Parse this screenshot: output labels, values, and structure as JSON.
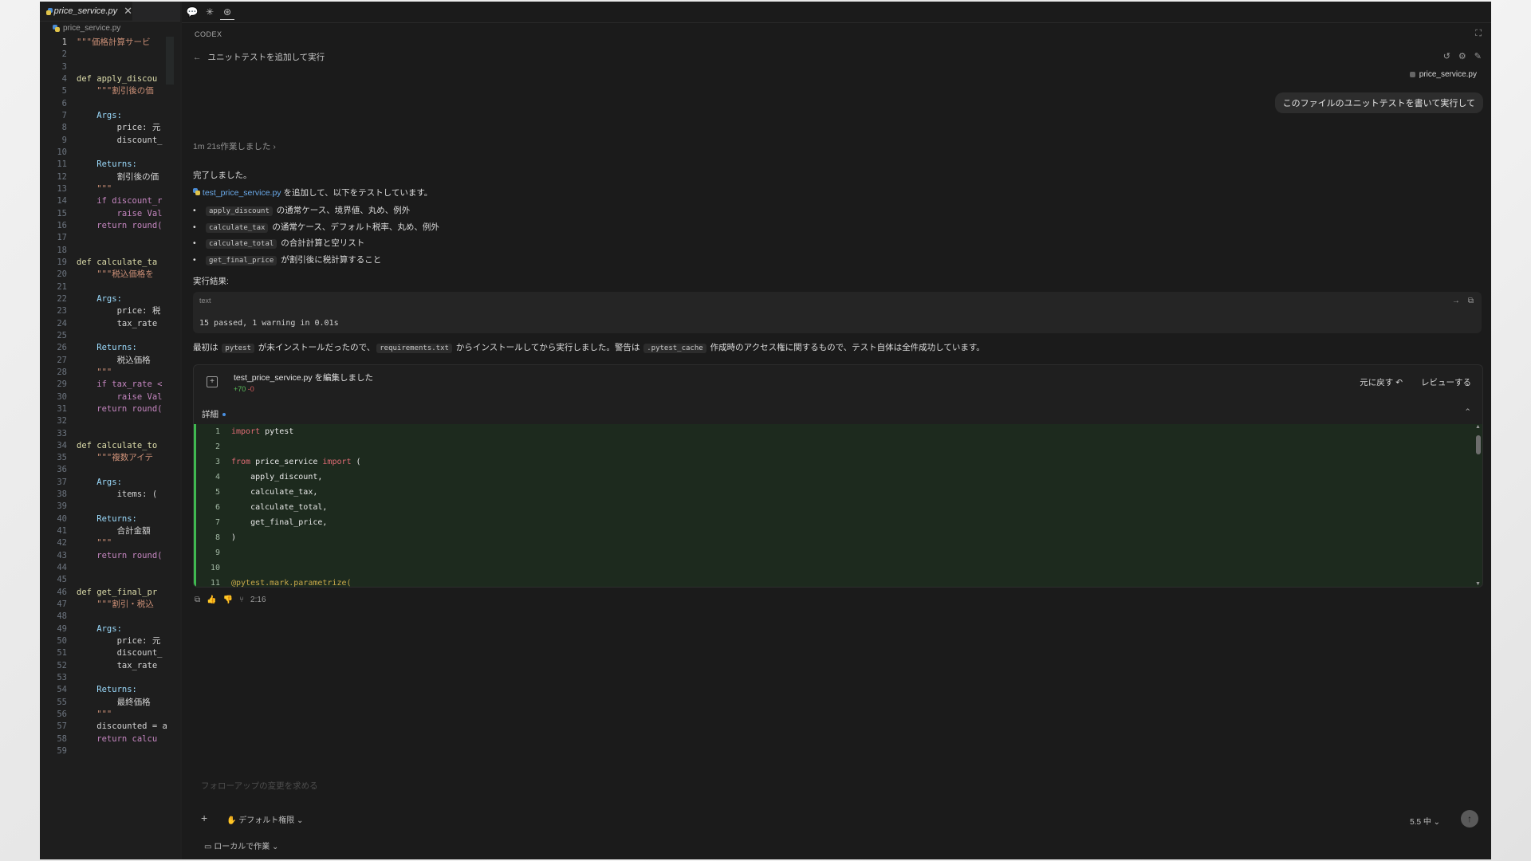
{
  "editor": {
    "tab_label": "price_service.py",
    "breadcrumb": "price_service.py",
    "lines": [
      {
        "n": "1",
        "t": "\"\"\"価格計算サービ"
      },
      {
        "n": "2",
        "t": ""
      },
      {
        "n": "3",
        "t": ""
      },
      {
        "n": "4",
        "t": "def apply_discou"
      },
      {
        "n": "5",
        "t": "    \"\"\"割引後の価"
      },
      {
        "n": "6",
        "t": ""
      },
      {
        "n": "7",
        "t": "    Args:"
      },
      {
        "n": "8",
        "t": "        price: 元"
      },
      {
        "n": "9",
        "t": "        discount_"
      },
      {
        "n": "10",
        "t": ""
      },
      {
        "n": "11",
        "t": "    Returns:"
      },
      {
        "n": "12",
        "t": "        割引後の価"
      },
      {
        "n": "13",
        "t": "    \"\"\""
      },
      {
        "n": "14",
        "t": "    if discount_r"
      },
      {
        "n": "15",
        "t": "        raise Val"
      },
      {
        "n": "16",
        "t": "    return round("
      },
      {
        "n": "17",
        "t": ""
      },
      {
        "n": "18",
        "t": ""
      },
      {
        "n": "19",
        "t": "def calculate_ta"
      },
      {
        "n": "20",
        "t": "    \"\"\"税込価格を"
      },
      {
        "n": "21",
        "t": ""
      },
      {
        "n": "22",
        "t": "    Args:"
      },
      {
        "n": "23",
        "t": "        price: 税"
      },
      {
        "n": "24",
        "t": "        tax_rate"
      },
      {
        "n": "25",
        "t": ""
      },
      {
        "n": "26",
        "t": "    Returns:"
      },
      {
        "n": "27",
        "t": "        税込価格"
      },
      {
        "n": "28",
        "t": "    \"\"\""
      },
      {
        "n": "29",
        "t": "    if tax_rate <"
      },
      {
        "n": "30",
        "t": "        raise Val"
      },
      {
        "n": "31",
        "t": "    return round("
      },
      {
        "n": "32",
        "t": ""
      },
      {
        "n": "33",
        "t": ""
      },
      {
        "n": "34",
        "t": "def calculate_to"
      },
      {
        "n": "35",
        "t": "    \"\"\"複数アイテ"
      },
      {
        "n": "36",
        "t": ""
      },
      {
        "n": "37",
        "t": "    Args:"
      },
      {
        "n": "38",
        "t": "        items: ("
      },
      {
        "n": "39",
        "t": ""
      },
      {
        "n": "40",
        "t": "    Returns:"
      },
      {
        "n": "41",
        "t": "        合計金額"
      },
      {
        "n": "42",
        "t": "    \"\"\""
      },
      {
        "n": "43",
        "t": "    return round("
      },
      {
        "n": "44",
        "t": ""
      },
      {
        "n": "45",
        "t": ""
      },
      {
        "n": "46",
        "t": "def get_final_pr"
      },
      {
        "n": "47",
        "t": "    \"\"\"割引・税込"
      },
      {
        "n": "48",
        "t": ""
      },
      {
        "n": "49",
        "t": "    Args:"
      },
      {
        "n": "50",
        "t": "        price: 元"
      },
      {
        "n": "51",
        "t": "        discount_"
      },
      {
        "n": "52",
        "t": "        tax_rate"
      },
      {
        "n": "53",
        "t": ""
      },
      {
        "n": "54",
        "t": "    Returns:"
      },
      {
        "n": "55",
        "t": "        最終価格"
      },
      {
        "n": "56",
        "t": "    \"\"\""
      },
      {
        "n": "57",
        "t": "    discounted = a"
      },
      {
        "n": "58",
        "t": "    return calcu"
      },
      {
        "n": "59",
        "t": ""
      }
    ]
  },
  "panel": {
    "header": "CODEX",
    "back_label": "ユニットテストを追加して実行",
    "file_chip": "price_service.py",
    "user_message": "このファイルのユニットテストを書いて実行して",
    "worked": "1m 21s作業しました",
    "done": "完了しました。",
    "added_file": "test_price_service.py",
    "added_suffix": " を追加して、以下をテストしています。",
    "bullets": [
      {
        "code": "apply_discount",
        "text": " の通常ケース、境界値、丸め、例外"
      },
      {
        "code": "calculate_tax",
        "text": " の通常ケース、デフォルト税率、丸め、例外"
      },
      {
        "code": "calculate_total",
        "text": " の合計計算と空リスト"
      },
      {
        "code": "get_final_price",
        "text": " が割引後に税計算すること"
      }
    ],
    "result_label": "実行結果:",
    "code_lang": "text",
    "code_output": "15 passed, 1 warning in 0.01s",
    "summary": {
      "p1": "最初は ",
      "c1": "pytest",
      "p2": " が未インストールだったので、",
      "c2": "requirements.txt",
      "p3": " からインストールしてから実行しました。警告は ",
      "c3": ".pytest_cache",
      "p4": " 作成時のアクセス権に関するもので、テスト自体は全件成功しています。"
    },
    "edit_card": {
      "title": "test_price_service.py を編集しました",
      "plus": "+70",
      "minus": "-0",
      "revert_label": "元に戻す",
      "review_label": "レビューする",
      "details_label": "詳細"
    },
    "diff_lines": [
      {
        "n": "1",
        "k": "import",
        "t": " pytest"
      },
      {
        "n": "2",
        "k": "",
        "t": ""
      },
      {
        "n": "3",
        "k": "from",
        "t": " price_service ",
        "k2": "import",
        "t2": " ("
      },
      {
        "n": "4",
        "k": "",
        "t": "    apply_discount,"
      },
      {
        "n": "5",
        "k": "",
        "t": "    calculate_tax,"
      },
      {
        "n": "6",
        "k": "",
        "t": "    calculate_total,"
      },
      {
        "n": "7",
        "k": "",
        "t": "    get_final_price,"
      },
      {
        "n": "8",
        "k": "",
        "t": ")"
      },
      {
        "n": "9",
        "k": "",
        "t": ""
      },
      {
        "n": "10",
        "k": "",
        "t": ""
      },
      {
        "n": "11",
        "k": "",
        "t": "",
        "dec": "@pytest.mark.parametrize("
      }
    ],
    "elapsed": "2:16",
    "follow_placeholder": "フォローアップの変更を求める",
    "permission_label": "デフォルト権限",
    "local_label": "ローカルで作業",
    "model_label": "5.5 中"
  },
  "colors": {
    "accent": "#4a90e2",
    "added": "#3fb950",
    "removed": "#d05a5a",
    "diff_bg": "#1d2a1e"
  }
}
